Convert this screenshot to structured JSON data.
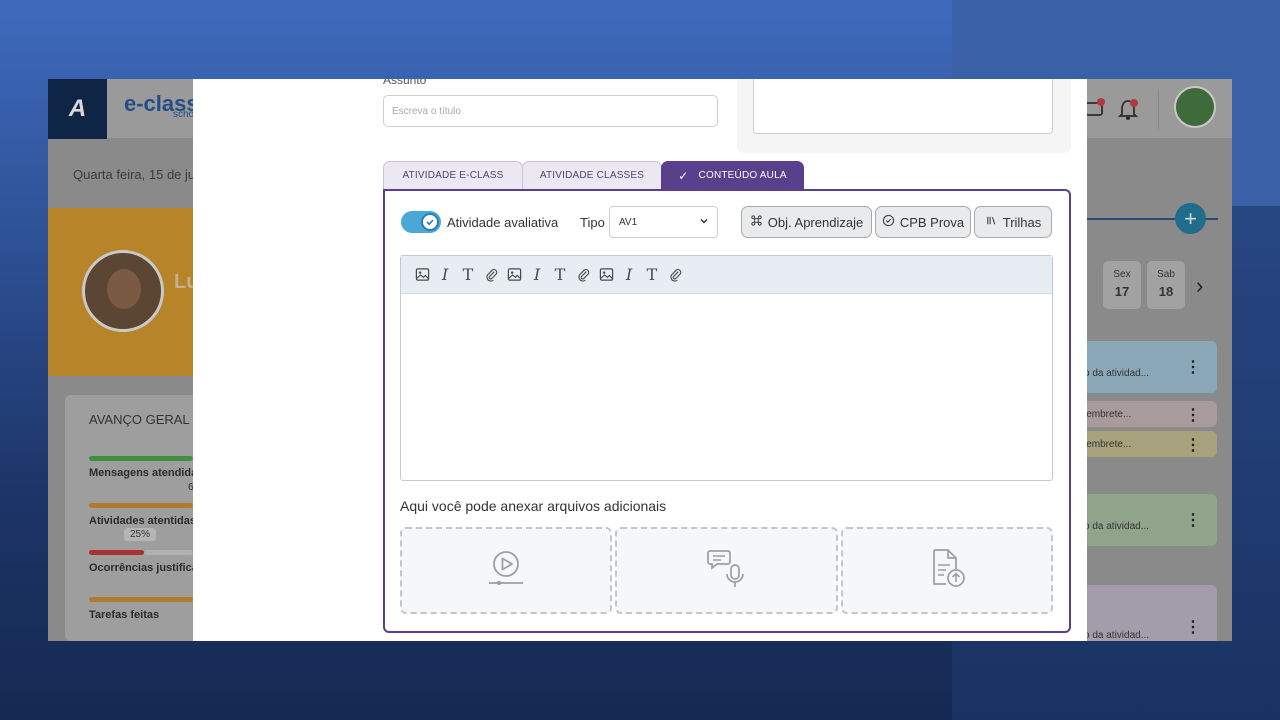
{
  "dashboard": {
    "logo_letter": "A",
    "brand": "e-class",
    "brand_sub": "scho",
    "date": "Quarta feira, 15 de juni",
    "student_name_partial": "Lu",
    "avanco_title": "AVANÇO GERAL",
    "progress_items": [
      {
        "label": "Mensagens atendidas",
        "color": "#3f8f3f"
      },
      {
        "label": "Atividades atentidas",
        "color": "#b07b2a"
      },
      {
        "label": "Ocorrências justificad",
        "color": "#a83232"
      },
      {
        "label": "Tarefas feitas",
        "color": "#b07b2a"
      }
    ],
    "pct_pill": "25%",
    "six": "6",
    "days": [
      {
        "name": "Sex",
        "num": "17"
      },
      {
        "name": "Sab",
        "num": "18"
      }
    ],
    "right_cards": [
      {
        "text": "o da atividad...",
        "color": "#8ba8b8"
      },
      {
        "text": "lembrete...",
        "color": "#a99b9b"
      },
      {
        "text": "lembrete...",
        "color": "#a8a27c"
      },
      {
        "text": "o da atividad...",
        "color": "#8fa48a"
      },
      {
        "text": "o da atividad...",
        "color": "#a39dab"
      }
    ]
  },
  "modal": {
    "assunto_label": "Assunto",
    "titulo_placeholder": "Escreva o título",
    "tabs": [
      {
        "label": "ATIVIDADE E-CLASS",
        "active": false
      },
      {
        "label": "ATIVIDADE CLASSES",
        "active": false
      },
      {
        "label": "CONTEÚDO AULA",
        "active": true
      }
    ],
    "toggle_label": "Atividade avaliativa",
    "toggle_on": true,
    "tipo_label": "Tipo",
    "tipo_value": "AV1",
    "buttons": {
      "obj": "Obj. Aprendizaje",
      "cpb": "CPB Prova",
      "trilhas": "Trilhas"
    },
    "toolbar_icons": [
      "image-icon",
      "italic-icon",
      "text-icon",
      "attach-icon",
      "image-icon",
      "italic-icon",
      "text-icon",
      "attach-icon",
      "image-icon",
      "italic-icon",
      "text-icon",
      "attach-icon"
    ],
    "anexar_text": "Aqui você pode anexar arquivos adicionais",
    "upload_zones": [
      "video-upload-icon",
      "audio-upload-icon",
      "file-upload-icon"
    ]
  },
  "colors": {
    "accent_purple": "#5a3f8d",
    "toggle_blue": "#4aa8d8"
  }
}
